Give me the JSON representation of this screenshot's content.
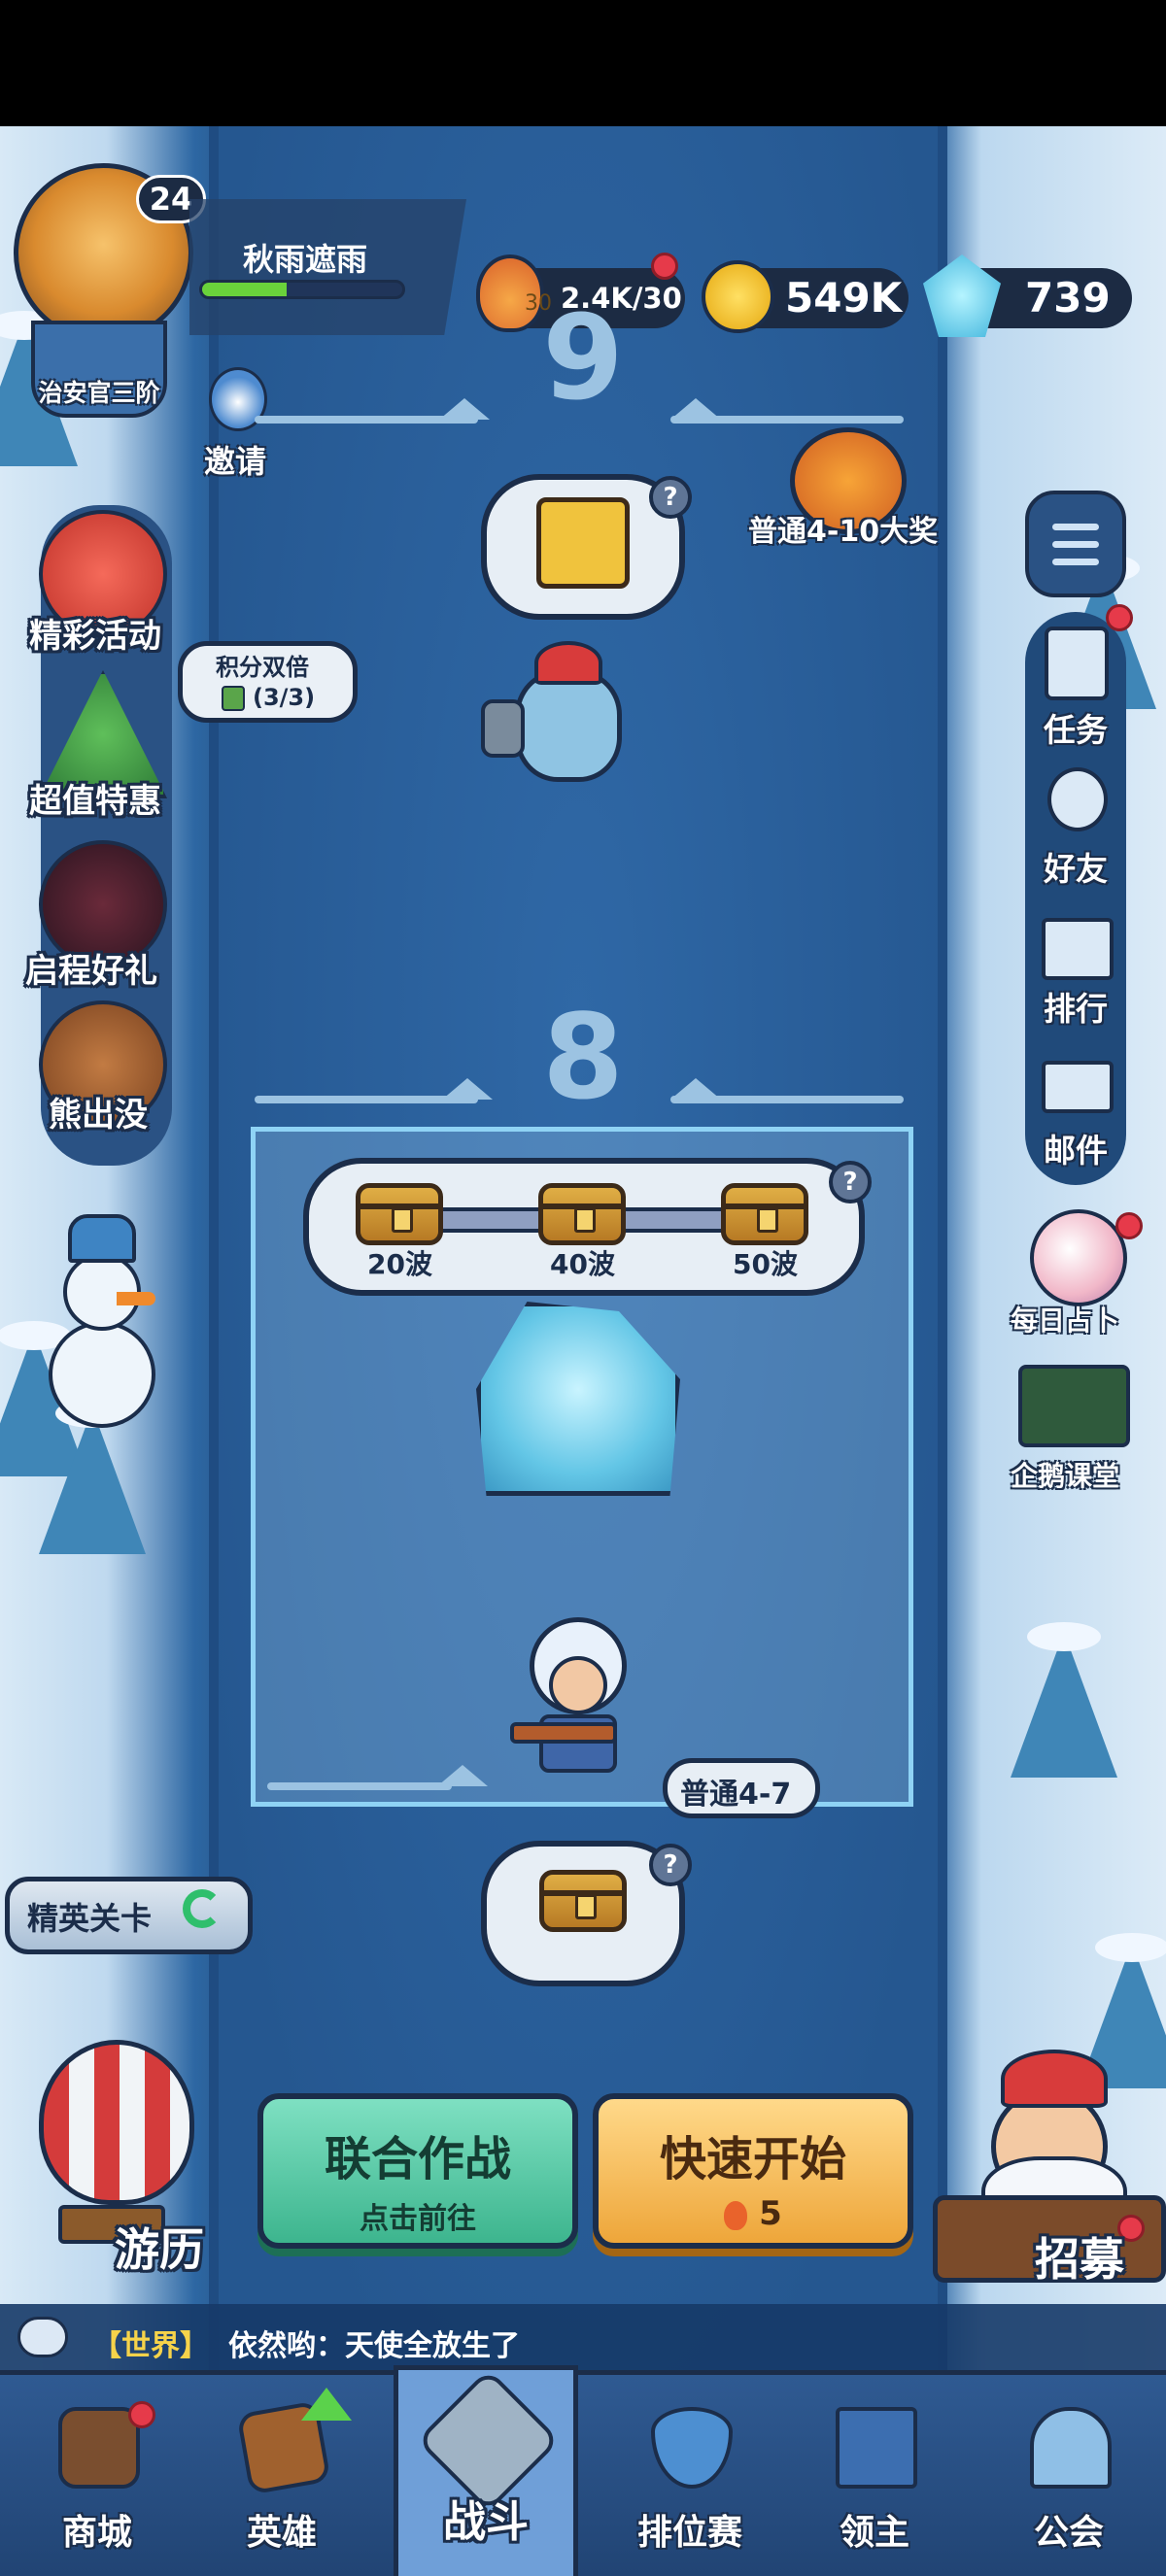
{
  "player": {
    "level": "24",
    "name": "秋雨遮雨",
    "rank": "治安官三阶",
    "xp_fraction": 0.42
  },
  "resources": {
    "stamina": "2.4K/30",
    "stamina_small": "30",
    "coins": "549K",
    "gems": "739"
  },
  "invite": {
    "label": "邀请"
  },
  "left_menu": [
    {
      "label": "精彩活动",
      "icon": "gift-box-icon"
    },
    {
      "label": "超值特惠",
      "icon": "christmas-tree-icon"
    },
    {
      "label": "启程好礼",
      "icon": "dragon-icon"
    },
    {
      "label": "熊出没",
      "icon": "bear-icon"
    }
  ],
  "double_points": {
    "title": "积分双倍",
    "count": "(3/3)"
  },
  "grand_prize": {
    "label": "普通4-10大奖"
  },
  "right_menu": [
    {
      "label": "任务",
      "icon": "clipboard-icon"
    },
    {
      "label": "好友",
      "icon": "friends-icon"
    },
    {
      "label": "排行",
      "icon": "podium-icon"
    },
    {
      "label": "邮件",
      "icon": "mail-icon"
    }
  ],
  "side_extras": [
    {
      "label": "每日占卜",
      "icon": "crystal-ball-icon"
    },
    {
      "label": "企鹅课堂",
      "icon": "penguin-teacher-icon"
    }
  ],
  "stages": {
    "stage9": "9",
    "stage8": "8"
  },
  "wave_rewards": [
    {
      "label": "20波"
    },
    {
      "label": "40波"
    },
    {
      "label": "50波"
    }
  ],
  "current_stage": {
    "label": "普通4-7"
  },
  "elite": {
    "label": "精英关卡"
  },
  "travel": {
    "label": "游历"
  },
  "recruit": {
    "label": "招募"
  },
  "coop_button": {
    "title": "联合作战",
    "subtitle": "点击前往"
  },
  "quick_start": {
    "title": "快速开始",
    "cost": "5"
  },
  "chat": {
    "channel": "【世界】",
    "message": "依然哟：天使全放生了"
  },
  "tabs": [
    {
      "label": "商城",
      "icon": "shop-icon"
    },
    {
      "label": "英雄",
      "icon": "hero-card-icon"
    },
    {
      "label": "战斗",
      "icon": "battle-weapons-icon"
    },
    {
      "label": "排位赛",
      "icon": "ranked-shield-icon"
    },
    {
      "label": "领主",
      "icon": "lord-banner-icon"
    },
    {
      "label": "公会",
      "icon": "guild-castle-icon"
    }
  ],
  "colors": {
    "stamina": "#e2792b",
    "coin": "#f4c430",
    "gem": "#69d7f0",
    "accent_green": "#52d1a4",
    "accent_orange": "#f3b543"
  }
}
